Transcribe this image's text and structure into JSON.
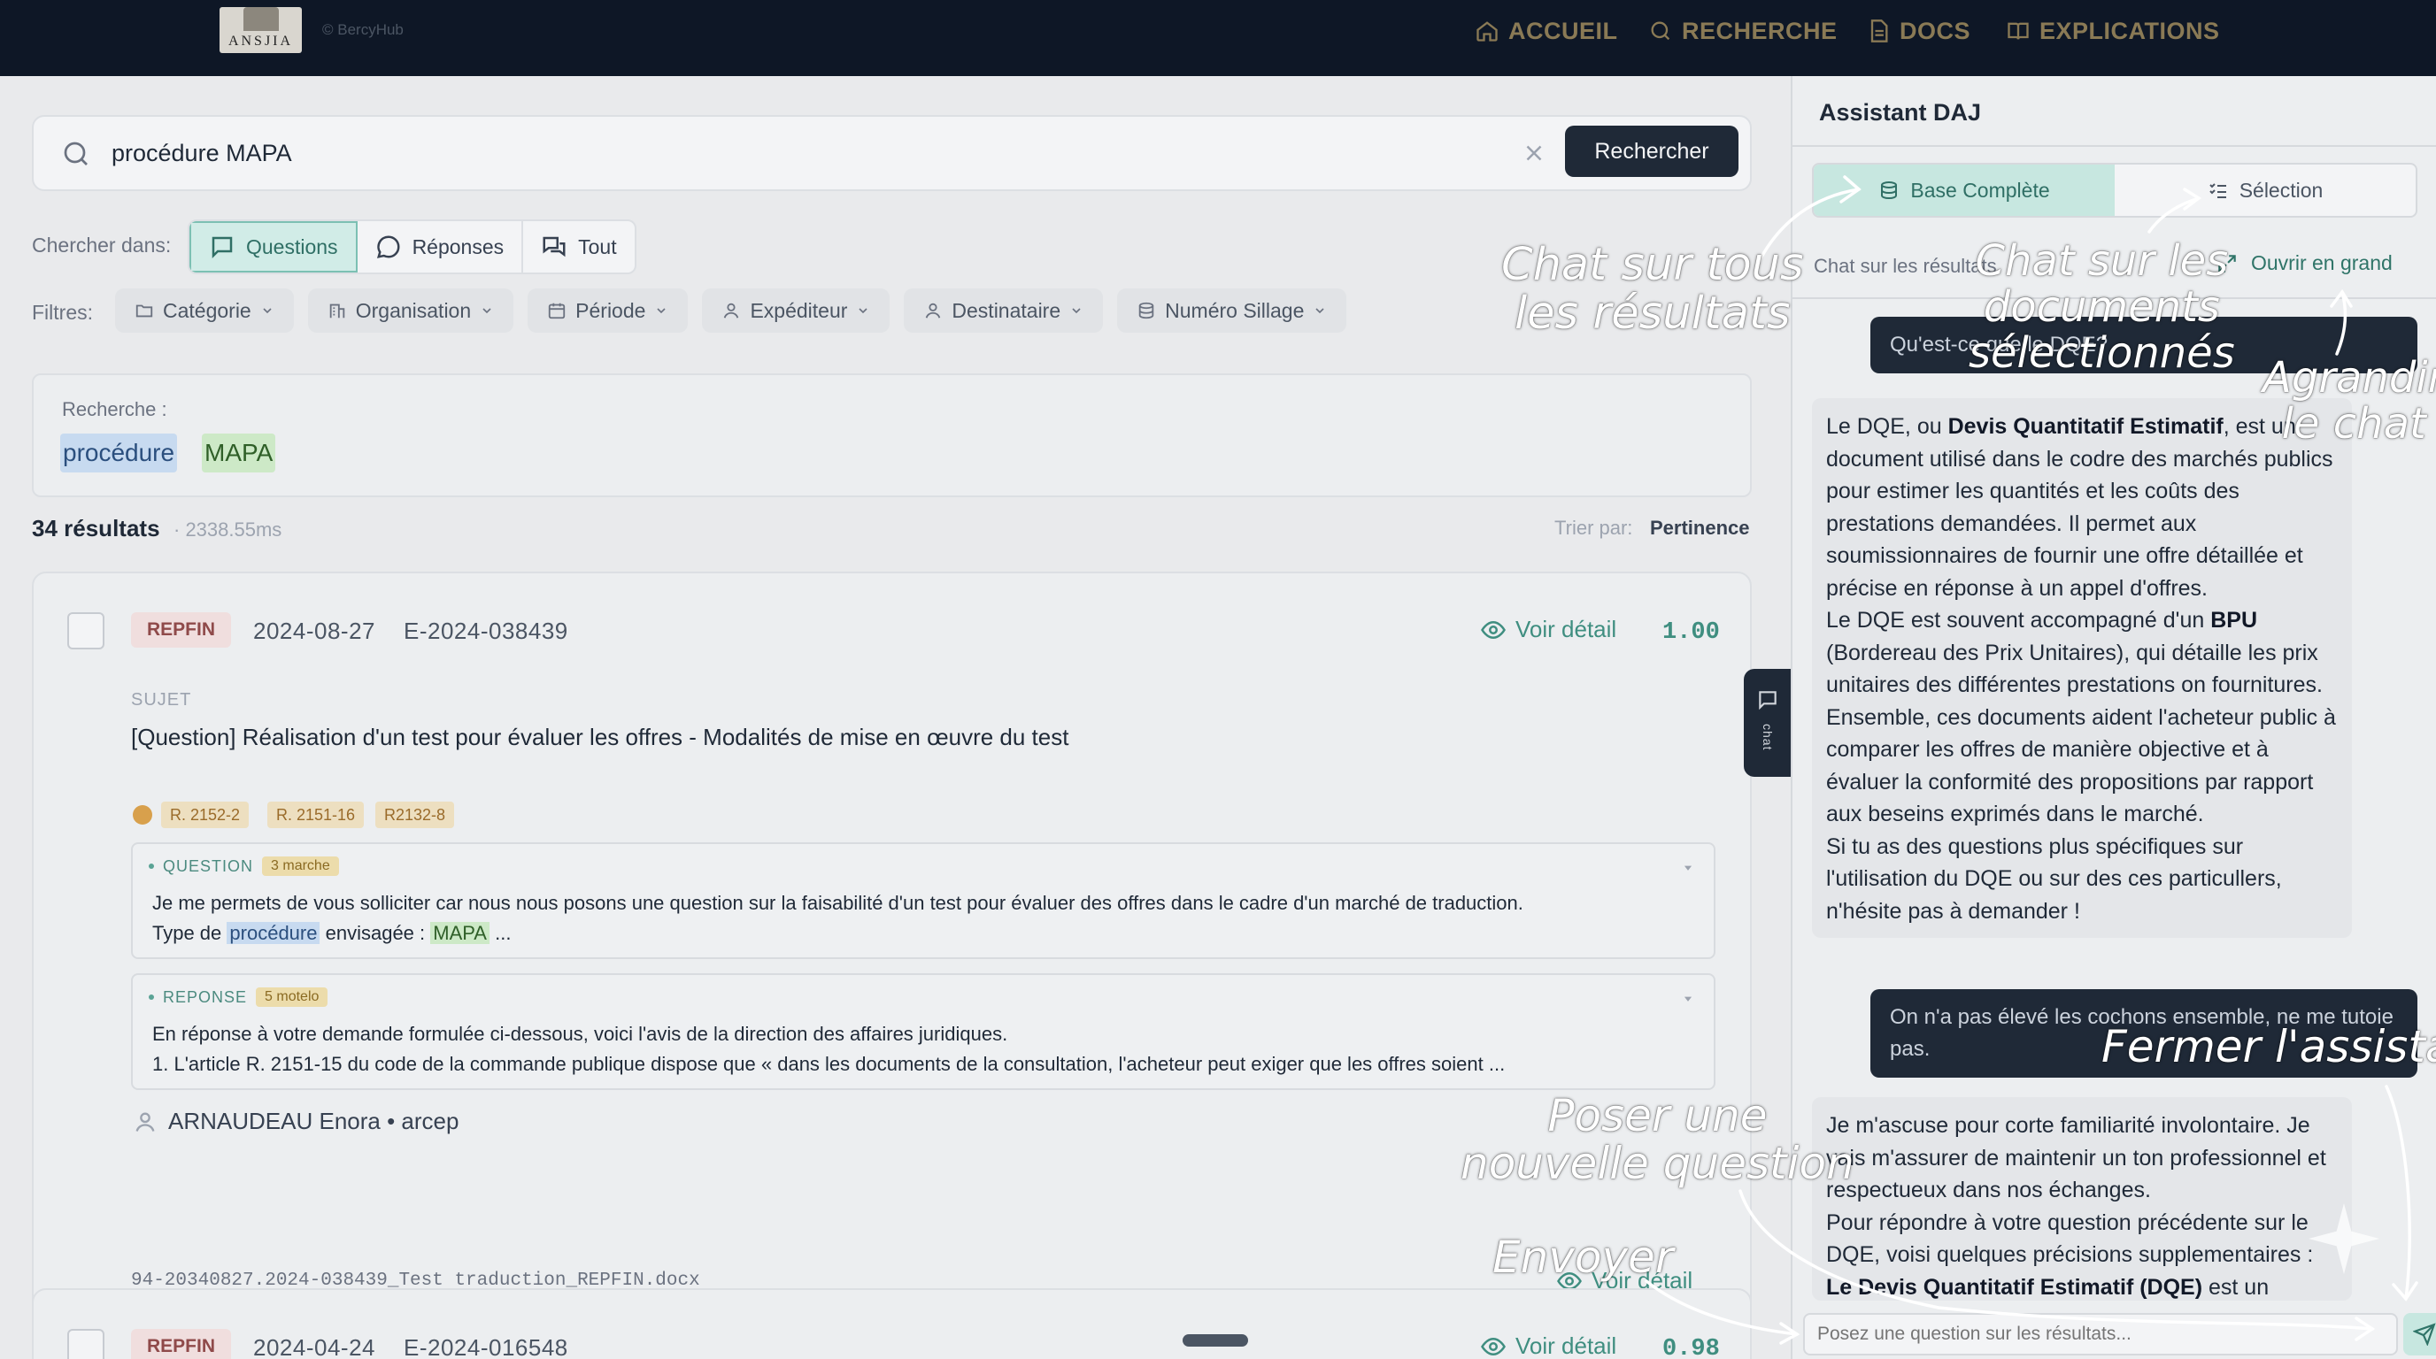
{
  "header": {
    "logo_text": "ANSJIA",
    "brand": "© BercyHub",
    "nav": [
      "ACCUEIL",
      "RECHERCHE",
      "DOCS",
      "EXPLICATIONS"
    ]
  },
  "search": {
    "value": "procédure MAPA",
    "button": "Rechercher",
    "scope_label": "Chercher dans:",
    "scopes": [
      "Questions",
      "Réponses",
      "Tout"
    ],
    "active_scope": "Questions",
    "filters_label": "Filtres:",
    "filters": [
      "Catégorie",
      "Organisation",
      "Période",
      "Expéditeur",
      "Destinataire",
      "Numéro Sillage"
    ]
  },
  "query": {
    "label": "Recherche :",
    "terms": [
      "procédure",
      "MAPA"
    ]
  },
  "results": {
    "count": "34 résultats",
    "time": "· 2338.55ms",
    "sort_label": "Trier par:",
    "sort_value": "Pertinence"
  },
  "card1": {
    "tag": "REPFIN",
    "date": "2024-08-27",
    "ref": "E-2024-038439",
    "voir": "Voir détail",
    "score": "1.00",
    "subject_label": "SUJET",
    "subject": "[Question] Réalisation d'un test pour évaluer les offres - Modalités de mise en œuvre du test",
    "refs": [
      "R. 2152-2",
      "R. 2151-16",
      "R2132-8"
    ],
    "question_label": "QUESTION",
    "question_badge": "3 marche",
    "question_line1": "Je me permets de vous solliciter car nous nous posons une question sur la faisabilité d'un test pour évaluer des offres dans le cadre d'un marché de traduction.",
    "question_line2_a": "Type de",
    "question_line2_hl1": "procédure",
    "question_line2_b": "envisagée :",
    "question_line2_hl2": "MAPA",
    "question_line2_c": "...",
    "answer_label": "REPONSE",
    "answer_badge": "5 motelo",
    "answer_line1": "En réponse à votre demande formulée ci-dessous, voici l'avis de la direction des affaires juridiques.",
    "answer_line2": "1. L'article R. 2151-15 du code de la commande publique dispose que « dans les documents de la consultation, l'acheteur peut exiger que les offres soient ...",
    "sender": "ARNAUDEAU Enora • arcep",
    "filename": "94-20340827.2024-038439_Test traduction_REPFIN.docx",
    "voir2": "Voir détail"
  },
  "card2": {
    "tag": "REPFIN",
    "date": "2024-04-24",
    "ref": "E-2024-016548",
    "voir": "Voir détail",
    "score": "0.98"
  },
  "chat_tab": "chat",
  "panel": {
    "title": "Assistant DAJ",
    "tab_full": "Base Complète",
    "tab_selection": "Sélection",
    "context": "Chat sur les résultats",
    "open_big": "Ouvrir en grand",
    "msg1": "Qu'est-ce que le DQE?",
    "msg2_html": "Le DQE, ou <b>Devis Quantitatif Estimatif</b>, est un document utilisé dans le codre des marchés publics pour estimer les quantités et les coûts des prestations demandées. Il permet aux soumissionnaires de fournir une offre détaillée et précise en réponse à un appel d'offres.<br>Le DQE est souvent accompagné d'un <b>BPU</b> (Bordereau des Prix Unitaires), qui détaille les prix unitaires des différentes prestations on fournitures. Ensemble, ces documents aident l'acheteur public à comparer les offres de manière objective et à évaluer la conformité des propositions par rapport aux beseins exprimés dans le marché.<br>Si tu as des questions plus spécifiques sur l'utilisation du DQE ou sur des ces particullers, n'hésite pas à demander !",
    "msg3": "On n'a pas élevé les cochons ensemble, ne me tutoie pas.",
    "msg4_html": "Je m'ascuse pour corte familiarité involontaire. Je vais m'assurer de maintenir un ton professionnel et respectueux dans nos échanges.<br>Pour répondre à votre question précédente sur le DQE, voisi quelques précisions supplementaires :<br><b>Le Devis Quantitatif Estimatif (DQE)</b> est un",
    "input_placeholder": "Posez une question sur les résultats..."
  },
  "annotations": {
    "a1": "Chat sur tous\nles résultats",
    "a2": "Chat sur les\ndocuments\nsélectionnés",
    "a3": "Agrandir\nle chat",
    "a4": "Fermer l'assistant",
    "a5": "Poser une\nnouvelle question",
    "a6": "Envoyer"
  },
  "colors": {
    "accent": "#3f8e80",
    "nav_bg": "#0e1726",
    "nav_text": "#8a7a55"
  }
}
